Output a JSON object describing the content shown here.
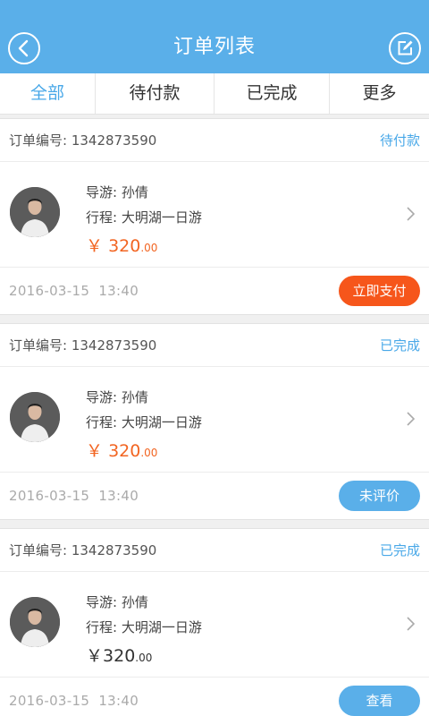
{
  "header": {
    "title": "订单列表",
    "back_icon": "chevron-left-icon",
    "edit_icon": "edit-icon",
    "color": "#5aafe9"
  },
  "tabs": [
    {
      "label": "全部",
      "active": true
    },
    {
      "label": "待付款",
      "active": false
    },
    {
      "label": "已完成",
      "active": false
    },
    {
      "label": "更多",
      "active": false
    }
  ],
  "orders": [
    {
      "order_label": "订单编号:",
      "order_no": "1342873590",
      "status": "待付款",
      "guide_label": "导游:",
      "guide": "孙倩",
      "trip_label": "行程:",
      "trip": "大明湖一日游",
      "currency": "￥",
      "price_int": "320",
      "price_dec": ".00",
      "date": "2016-03-15",
      "time": "13:40",
      "action": "立即支付",
      "action_color": "#f6561b"
    },
    {
      "order_label": "订单编号:",
      "order_no": "1342873590",
      "status": "已完成",
      "guide_label": "导游:",
      "guide": "孙倩",
      "trip_label": "行程:",
      "trip": "大明湖一日游",
      "currency": "￥",
      "price_int": "320",
      "price_dec": ".00",
      "date": "2016-03-15",
      "time": "13:40",
      "action": "未评价",
      "action_color": "#5aafe9"
    },
    {
      "order_label": "订单编号:",
      "order_no": "1342873590",
      "status": "已完成",
      "guide_label": "导游:",
      "guide": "孙倩",
      "trip_label": "行程:",
      "trip": "大明湖一日游",
      "currency": "￥",
      "price_int": "320",
      "price_dec": ".00",
      "date": "2016-03-15",
      "time": "13:40",
      "action": "查看",
      "action_color": "#5aafe9"
    }
  ]
}
